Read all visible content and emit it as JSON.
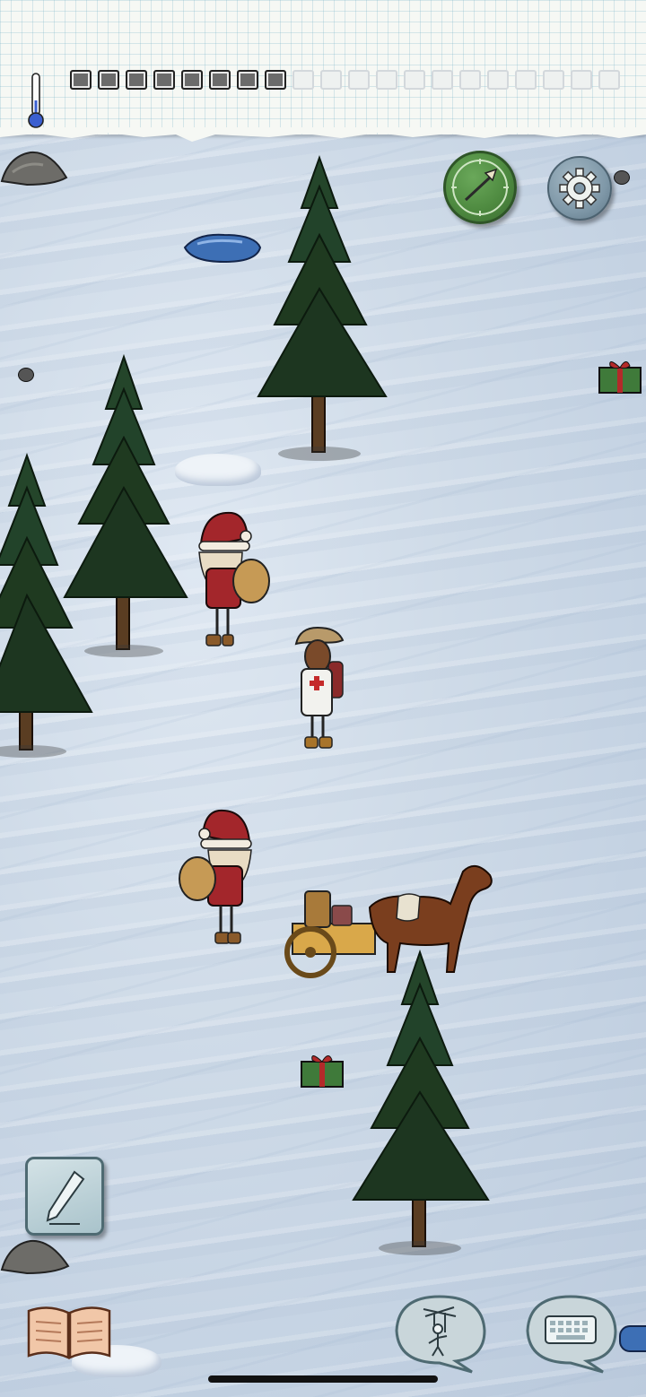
{
  "hud": {
    "temperature_icon": "thermometer-icon",
    "food_pips": {
      "filled": 8,
      "total": 20
    }
  },
  "buttons": {
    "home_marker": "compass-arrow-icon",
    "settings": "gear-icon",
    "pencil_note": "pencil-icon",
    "tech_book": "open-book-icon",
    "emote": "puppet-bubble-icon",
    "keyboard": "keyboard-bubble-icon"
  },
  "colors": {
    "snow": "#cfdbe8",
    "paper": "#f6f8f4",
    "tree_green": "#1f3a20",
    "santa_red": "#a3262b",
    "gift_green": "#3f7a3a",
    "button_green": "#4e8a40",
    "button_grey": "#7f98a8"
  }
}
